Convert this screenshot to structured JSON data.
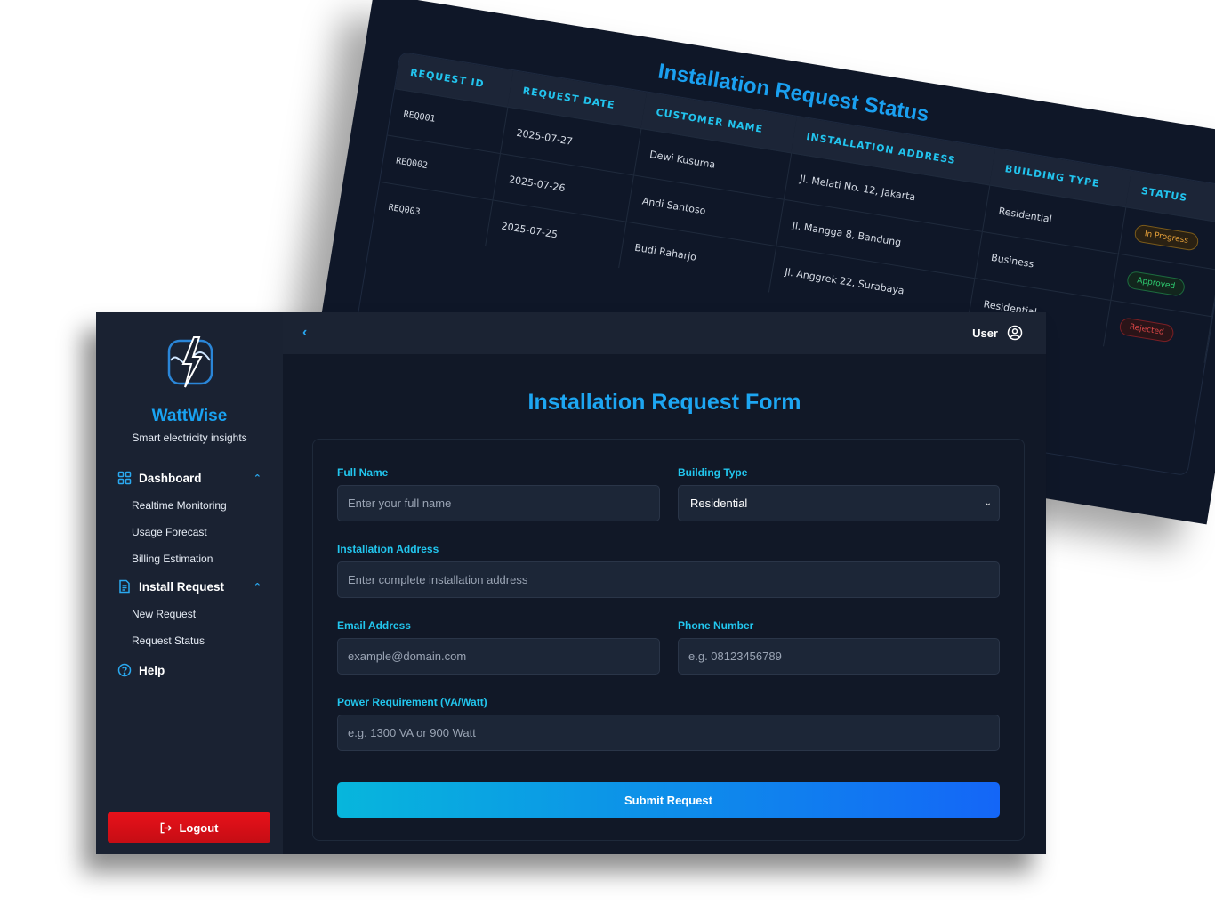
{
  "status_view": {
    "title": "Installation Request Status",
    "columns": [
      "Request ID",
      "Request Date",
      "Customer Name",
      "Installation Address",
      "Building Type",
      "Status"
    ],
    "rows": [
      {
        "id": "REQ001",
        "date": "2025-07-27",
        "customer": "Dewi Kusuma",
        "address": "Jl. Melati No. 12, Jakarta",
        "building": "Residential",
        "status": "In Progress"
      },
      {
        "id": "REQ002",
        "date": "2025-07-26",
        "customer": "Andi Santoso",
        "address": "Jl. Mangga 8, Bandung",
        "building": "Business",
        "status": "Approved"
      },
      {
        "id": "REQ003",
        "date": "2025-07-25",
        "customer": "Budi Raharjo",
        "address": "Jl. Anggrek 22, Surabaya",
        "building": "Residential",
        "status": "Rejected"
      }
    ]
  },
  "sidebar": {
    "brand": "WattWise",
    "tagline": "Smart electricity insights",
    "dashboard": {
      "label": "Dashboard",
      "items": [
        "Realtime Monitoring",
        "Usage Forecast",
        "Billing Estimation"
      ]
    },
    "install": {
      "label": "Install Request",
      "items": [
        "New Request",
        "Request Status"
      ]
    },
    "help": "Help",
    "logout": "Logout"
  },
  "topbar": {
    "user": "User",
    "back_icon": "chevron-left-icon"
  },
  "form": {
    "title": "Installation Request Form",
    "full_name": {
      "label": "Full Name",
      "placeholder": "Enter your full name"
    },
    "building_type": {
      "label": "Building Type",
      "value": "Residential"
    },
    "address": {
      "label": "Installation Address",
      "placeholder": "Enter complete installation address"
    },
    "email": {
      "label": "Email Address",
      "placeholder": "example@domain.com"
    },
    "phone": {
      "label": "Phone Number",
      "placeholder": "e.g. 08123456789"
    },
    "power": {
      "label": "Power Requirement (VA/Watt)",
      "placeholder": "e.g. 1300 VA or 900 Watt"
    },
    "submit": "Submit Request"
  },
  "colors": {
    "accent": "#1da6f2",
    "label": "#22c6ee",
    "danger": "#e8111a",
    "bg": "#111827"
  }
}
